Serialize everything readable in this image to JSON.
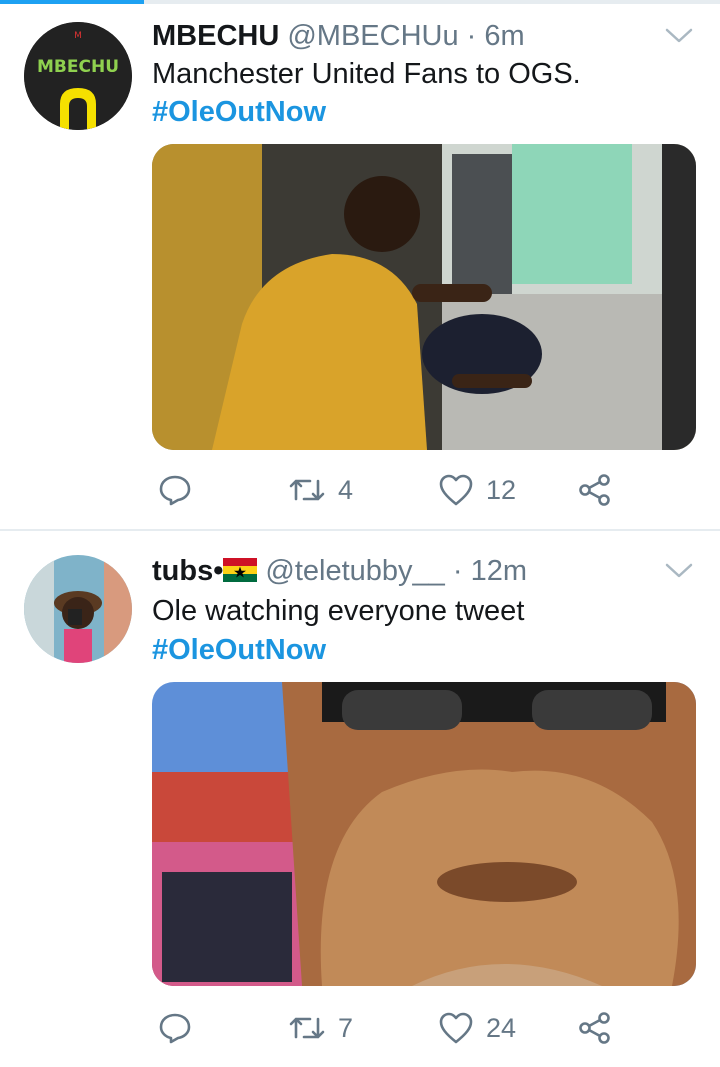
{
  "progress_fraction": 0.2,
  "tweets": [
    {
      "name": "MBECHU",
      "handle": "@MBECHUu",
      "sep": "·",
      "time": "6m",
      "text": "Manchester United Fans to OGS.",
      "hashtag": "#OleOutNow",
      "avatar_logo_text": "MBECHU",
      "retweets": "4",
      "likes": "12"
    },
    {
      "name": "tubs•",
      "handle": "@teletubby__",
      "sep": "·",
      "time": "12m",
      "text": "Ole watching everyone tweet",
      "hashtag": "#OleOutNow",
      "retweets": "7",
      "likes": "24"
    }
  ],
  "icons": {
    "reply": "reply-icon",
    "retweet": "retweet-icon",
    "like": "heart-icon",
    "share": "share-icon",
    "menu": "chevron-down-icon",
    "flag": "ghana-flag-icon"
  },
  "colors": {
    "link": "#1b95e0",
    "secondary": "#657786",
    "primary_text": "#14171a",
    "progress": "#1da1f2"
  }
}
